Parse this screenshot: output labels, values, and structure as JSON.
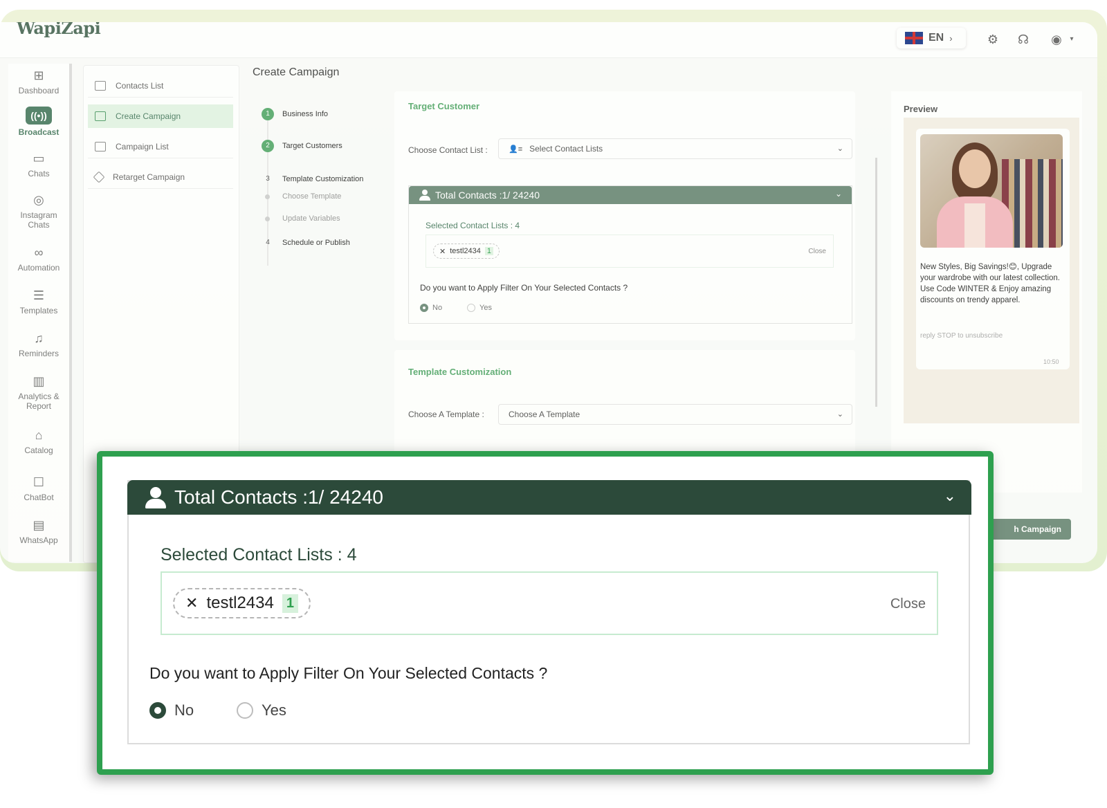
{
  "app": {
    "logo": "WapiZapi",
    "language": "EN"
  },
  "icon_sidebar": [
    {
      "label": "Dashboard",
      "icon": "grid-icon"
    },
    {
      "label": "Broadcast",
      "icon": "broadcast-icon",
      "active": true
    },
    {
      "label": "Chats",
      "icon": "chat-icon"
    },
    {
      "label": "Instagram Chats",
      "icon": "instagram-icon"
    },
    {
      "label": "Automation",
      "icon": "automation-icon"
    },
    {
      "label": "Templates",
      "icon": "templates-icon"
    },
    {
      "label": "Reminders",
      "icon": "bell-icon"
    },
    {
      "label": "Analytics & Report",
      "icon": "analytics-icon"
    },
    {
      "label": "Catalog",
      "icon": "store-icon"
    },
    {
      "label": "ChatBot",
      "icon": "chatbot-icon"
    },
    {
      "label": "WhatsApp",
      "icon": "whatsapp-icon"
    }
  ],
  "submenu": [
    {
      "label": "Contacts List"
    },
    {
      "label": "Create Campaign",
      "active": true
    },
    {
      "label": "Campaign List"
    },
    {
      "label": "Retarget Campaign"
    }
  ],
  "page_title": "Create Campaign",
  "stepper": {
    "steps": [
      {
        "num": "1",
        "label": "Business Info"
      },
      {
        "num": "2",
        "label": "Target Customers"
      },
      {
        "num": "3",
        "label": "Template Customization"
      },
      {
        "label": "Choose Template"
      },
      {
        "label": "Update Variables"
      },
      {
        "num": "4",
        "label": "Schedule or Publish"
      }
    ]
  },
  "target": {
    "title": "Target Customer",
    "contact_list_label": "Choose Contact List :",
    "contact_list_placeholder": "Select Contact Lists",
    "total_contacts": "Total Contacts :1/ 24240",
    "selected_label": "Selected Contact Lists : 4",
    "chip_name": "testl2434",
    "chip_count": "1",
    "close": "Close",
    "filter_question": "Do you want to Apply Filter On Your Selected Contacts ?",
    "radio_no": "No",
    "radio_yes": "Yes",
    "selected_option": "No"
  },
  "template": {
    "title": "Template Customization",
    "choose_label": "Choose A Template :",
    "choose_placeholder": "Choose A Template"
  },
  "preview": {
    "title": "Preview",
    "message": "New Styles, Big Savings!😊, Upgrade your wardrobe with our latest collection. Use Code WINTER & Enjoy amazing discounts on trendy apparel.",
    "footer": "reply STOP to unsubscribe",
    "time": "10:50"
  },
  "launch_button": "h Campaign",
  "colors": {
    "accent": "#2ea04f",
    "header_dark": "#2c4a3a",
    "header_muted": "#6f8b7a",
    "section_green": "#5aaa6f"
  }
}
